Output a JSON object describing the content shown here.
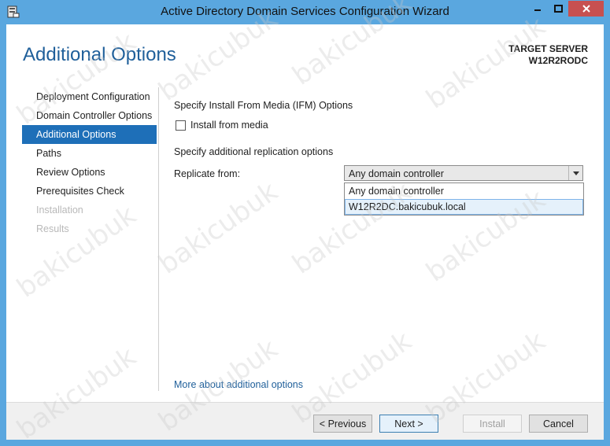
{
  "window": {
    "title": "Active Directory Domain Services Configuration Wizard"
  },
  "header": {
    "page_title": "Additional Options",
    "target_label": "TARGET SERVER",
    "target_name": "W12R2RODC"
  },
  "nav": {
    "items": [
      {
        "label": "Deployment Configuration",
        "state": "normal"
      },
      {
        "label": "Domain Controller Options",
        "state": "normal"
      },
      {
        "label": "Additional Options",
        "state": "active"
      },
      {
        "label": "Paths",
        "state": "normal"
      },
      {
        "label": "Review Options",
        "state": "normal"
      },
      {
        "label": "Prerequisites Check",
        "state": "normal"
      },
      {
        "label": "Installation",
        "state": "disabled"
      },
      {
        "label": "Results",
        "state": "disabled"
      }
    ]
  },
  "content": {
    "ifm_heading": "Specify Install From Media (IFM) Options",
    "install_from_media_label": "Install from media",
    "install_from_media_checked": false,
    "replication_heading": "Specify additional replication options",
    "replicate_from_label": "Replicate from:",
    "replicate_from_value": "Any domain controller",
    "replicate_from_options": [
      "Any domain controller",
      "W12R2DC.bakicubuk.local"
    ],
    "more_link": "More about additional options"
  },
  "footer": {
    "previous_label": "< Previous",
    "next_label": "Next >",
    "install_label": "Install",
    "cancel_label": "Cancel"
  },
  "watermark": "bakicubuk",
  "colors": {
    "titlebar": "#5aa7df",
    "accent": "#1e6fb8",
    "close": "#c75050"
  }
}
